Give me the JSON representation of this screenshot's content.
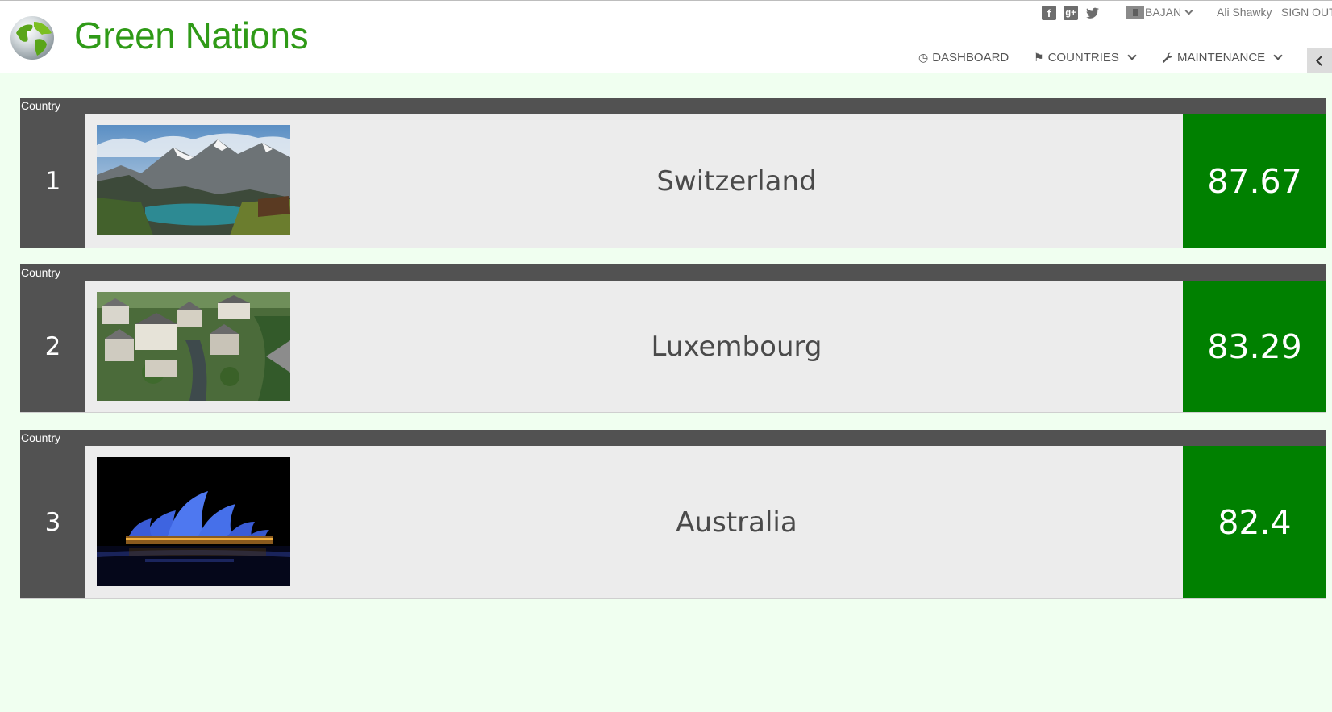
{
  "header": {
    "brand": "Green Nations",
    "social": [
      "facebook-icon",
      "google-plus-icon",
      "twitter-icon"
    ],
    "language": "BAJAN",
    "user_name": "Ali Shawky",
    "sign_out": "SIGN OUT"
  },
  "nav": {
    "dashboard": "DASHBOARD",
    "countries": "COUNTRIES",
    "maintenance": "MAINTENANCE"
  },
  "rankings": [
    {
      "label": "Country",
      "rank": "1",
      "name": "Switzerland",
      "score": "87.67",
      "image": "mountain-lake-photo"
    },
    {
      "label": "Country",
      "rank": "2",
      "name": "Luxembourg",
      "score": "83.29",
      "image": "old-town-photo"
    },
    {
      "label": "Country",
      "rank": "3",
      "name": "Australia",
      "score": "82.4",
      "image": "opera-house-photo"
    }
  ],
  "colors": {
    "brand": "#2f9a17",
    "score_bg": "#008000",
    "card_dark": "#525252",
    "page_bg": "#f0fff0"
  }
}
